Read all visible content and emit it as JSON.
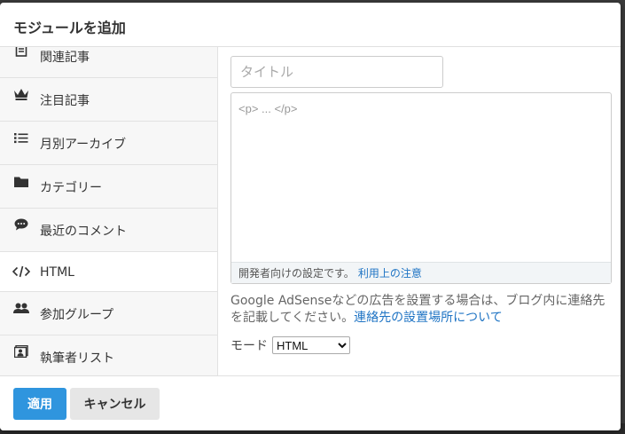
{
  "modal": {
    "title": "モジュールを追加"
  },
  "sidebar": {
    "items": [
      {
        "label": "関連記事",
        "icon": "document-icon"
      },
      {
        "label": "注目記事",
        "icon": "crown-icon"
      },
      {
        "label": "月別アーカイブ",
        "icon": "list-icon"
      },
      {
        "label": "カテゴリー",
        "icon": "folder-icon"
      },
      {
        "label": "最近のコメント",
        "icon": "comment-icon"
      },
      {
        "label": "HTML",
        "icon": "code-icon",
        "active": true
      },
      {
        "label": "参加グループ",
        "icon": "users-icon"
      },
      {
        "label": "執筆者リスト",
        "icon": "author-list-icon"
      }
    ]
  },
  "form": {
    "title_placeholder": "タイトル",
    "editor_placeholder": "<p> ... </p>",
    "editor_note": "開発者向けの設定です。",
    "editor_link": "利用上の注意",
    "help_text": "Google AdSenseなどの広告を設置する場合は、ブログ内に連絡先を記載してください。",
    "help_link": "連絡先の設置場所について",
    "mode_label": "モード",
    "mode_selected": "HTML"
  },
  "footer": {
    "apply_label": "適用",
    "cancel_label": "キャンセル"
  },
  "colors": {
    "primary": "#2f95de",
    "link": "#1f74c4"
  }
}
